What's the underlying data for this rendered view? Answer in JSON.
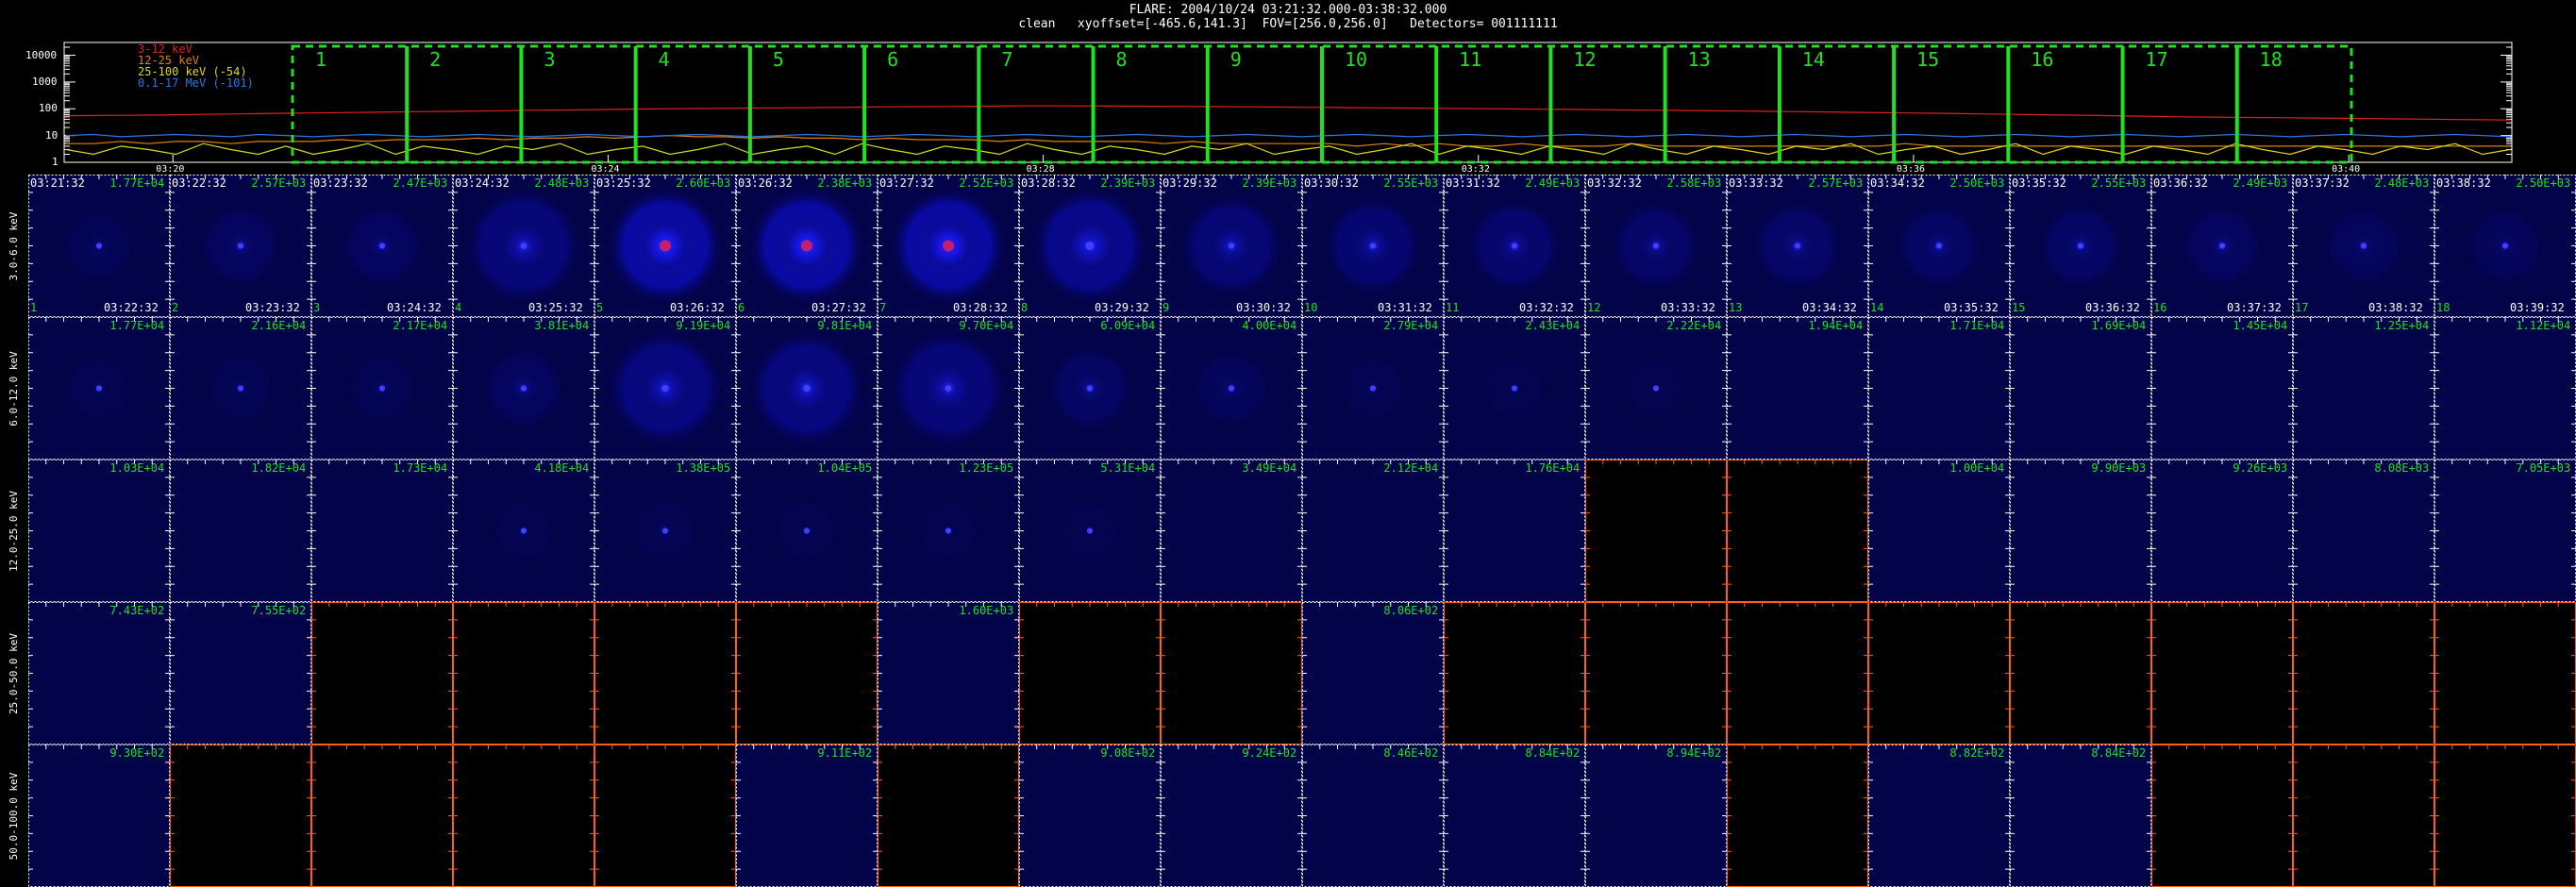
{
  "header": {
    "line1": "FLARE: 2004/10/24 03:21:32.000-03:38:32.000",
    "line2": "clean   xyoffset=[-465.6,141.3]  FOV=[256.0,256.0]   Detectors= 001111111"
  },
  "colors": {
    "red": "#e02020",
    "orange": "#e08010",
    "yellow": "#d8d820",
    "blue": "#2a78e8",
    "green": "#20e020",
    "frame": "#ff6010"
  },
  "chart_data": [
    {
      "type": "line",
      "title": "",
      "y_scale": "log",
      "ylim": [
        1,
        30000
      ],
      "y_ticks": [
        "10000",
        "1000",
        "100",
        "10",
        "1"
      ],
      "x_ticks": [
        "03:20",
        "03:24",
        "03:28",
        "03:32",
        "03:36",
        "03:40"
      ],
      "x_range": [
        "03:19:00",
        "03:41:30"
      ],
      "series": [
        {
          "name": "3-12 keV",
          "color_key": "red",
          "values": [
            55,
            56,
            57,
            58,
            60,
            62,
            64,
            66,
            68,
            70,
            72,
            74,
            76,
            78,
            80,
            82,
            85,
            88,
            90,
            92,
            95,
            98,
            100,
            102,
            104,
            106,
            108,
            110,
            112,
            115,
            118,
            120,
            122,
            124,
            126,
            128,
            128,
            127,
            126,
            125,
            124,
            122,
            120,
            118,
            116,
            114,
            112,
            110,
            108,
            106,
            104,
            102,
            100,
            98,
            96,
            94,
            92,
            90,
            88,
            86,
            84,
            82,
            80,
            78,
            76,
            74,
            72,
            70,
            68,
            66,
            64,
            62,
            60,
            58,
            56,
            54,
            52,
            50,
            49,
            48,
            47,
            46,
            45,
            44,
            43,
            42,
            41,
            40,
            39,
            38
          ]
        },
        {
          "name": "12-25 keV",
          "color_key": "orange",
          "values": [
            5,
            5,
            6,
            5,
            6,
            6,
            5,
            6,
            6,
            6,
            7,
            6,
            7,
            7,
            7,
            8,
            7,
            8,
            8,
            9,
            8,
            9,
            10,
            9,
            9,
            8,
            9,
            8,
            8,
            7,
            8,
            7,
            7,
            7,
            6,
            7,
            6,
            6,
            6,
            6,
            5,
            6,
            5,
            5,
            5,
            5,
            5,
            4,
            5,
            4,
            5,
            4,
            4,
            5,
            4,
            4,
            4,
            5,
            4,
            4,
            4,
            4,
            4,
            4,
            4,
            4,
            4,
            5,
            4,
            4,
            4,
            4,
            4,
            4,
            4,
            4,
            4,
            4,
            4,
            4,
            4,
            4,
            4,
            4,
            4,
            4,
            4,
            4,
            4,
            4
          ]
        },
        {
          "name": "25-100 keV (-54)",
          "color_key": "yellow",
          "values": [
            3,
            2,
            4,
            3,
            2,
            5,
            3,
            2,
            4,
            2,
            3,
            5,
            2,
            4,
            3,
            2,
            4,
            3,
            5,
            2,
            3,
            4,
            2,
            3,
            5,
            2,
            3,
            4,
            2,
            5,
            3,
            2,
            4,
            3,
            2,
            5,
            3,
            2,
            4,
            3,
            2,
            4,
            3,
            5,
            2,
            3,
            4,
            2,
            3,
            5,
            2,
            4,
            3,
            2,
            4,
            3,
            2,
            5,
            3,
            2,
            4,
            3,
            2,
            4,
            3,
            5,
            2,
            3,
            4,
            2,
            3,
            5,
            2,
            4,
            3,
            2,
            4,
            3,
            2,
            5,
            3,
            2,
            4,
            3,
            2,
            4,
            3,
            5,
            2,
            3
          ]
        },
        {
          "name": "0.1-17 MeV (-101)",
          "color_key": "blue",
          "values": [
            10,
            11,
            9,
            10,
            11,
            10,
            9,
            11,
            10,
            9,
            10,
            11,
            10,
            9,
            10,
            11,
            10,
            9,
            10,
            11,
            10,
            9,
            10,
            11,
            10,
            9,
            10,
            11,
            10,
            9,
            10,
            11,
            10,
            9,
            10,
            11,
            10,
            9,
            10,
            11,
            10,
            9,
            10,
            11,
            10,
            9,
            10,
            11,
            10,
            9,
            10,
            11,
            10,
            9,
            10,
            11,
            10,
            9,
            10,
            11,
            10,
            9,
            10,
            11,
            10,
            9,
            10,
            11,
            10,
            9,
            10,
            11,
            10,
            9,
            10,
            11,
            10,
            9,
            10,
            11,
            10,
            9,
            10,
            11,
            10,
            9,
            10,
            11,
            10,
            9
          ]
        }
      ],
      "intervals": [
        "1",
        "2",
        "3",
        "4",
        "5",
        "6",
        "7",
        "8",
        "9",
        "10",
        "11",
        "12",
        "13",
        "14",
        "15",
        "16",
        "17",
        "18"
      ]
    },
    {
      "type": "heatmap",
      "title": "",
      "energy_bands": [
        "3.0-6.0 keV",
        "6.0-12.0 keV",
        "12.0-25.0 keV",
        "25.0-50.0 keV",
        "50.0-100.0 keV"
      ],
      "start_times": [
        "03:21:32",
        "03:22:32",
        "03:23:32",
        "03:24:32",
        "03:25:32",
        "03:26:32",
        "03:27:32",
        "03:28:32",
        "03:29:32",
        "03:30:32",
        "03:31:32",
        "03:32:32",
        "03:33:32",
        "03:34:32",
        "03:35:32",
        "03:36:32",
        "03:37:32",
        "03:38:32"
      ],
      "end_times": [
        "03:22:32",
        "03:23:32",
        "03:24:32",
        "03:25:32",
        "03:26:32",
        "03:27:32",
        "03:28:32",
        "03:29:32",
        "03:30:32",
        "03:31:32",
        "03:32:32",
        "03:33:32",
        "03:34:32",
        "03:35:32",
        "03:36:32",
        "03:37:32",
        "03:38:32",
        "03:39:32"
      ],
      "interval_numbers": [
        "1",
        "2",
        "3",
        "4",
        "5",
        "6",
        "7",
        "8",
        "9",
        "10",
        "11",
        "12",
        "13",
        "14",
        "15",
        "16",
        "17",
        "18"
      ],
      "max_values": [
        [
          "1.77E+04",
          "2.57E+03",
          "2.47E+03",
          "2.48E+03",
          "2.60E+03",
          "2.38E+03",
          "2.52E+03",
          "2.39E+03",
          "2.39E+03",
          "2.55E+03",
          "2.49E+03",
          "2.58E+03",
          "2.57E+03",
          "2.50E+03",
          "2.55E+03",
          "2.49E+03",
          "2.48E+03",
          "2.50E+03"
        ],
        [
          "1.77E+04",
          "2.16E+04",
          "2.17E+04",
          "3.81E+04",
          "9.19E+04",
          "9.81E+04",
          "9.70E+04",
          "6.09E+04",
          "4.00E+04",
          "2.79E+04",
          "2.43E+04",
          "2.22E+04",
          "1.94E+04",
          "1.71E+04",
          "1.69E+04",
          "1.45E+04",
          "1.25E+04",
          "1.12E+04"
        ],
        [
          "1.03E+04",
          "1.82E+04",
          "1.73E+04",
          "4.18E+04",
          "1.38E+05",
          "1.04E+05",
          "1.23E+05",
          "5.31E+04",
          "3.49E+04",
          "2.12E+04",
          "1.76E+04",
          "",
          "",
          "1.00E+04",
          "9.90E+03",
          "9.26E+03",
          "8.08E+03",
          "7.05E+03"
        ],
        [
          "7.43E+02",
          "7.55E+02",
          "",
          "",
          "",
          "",
          "1.60E+03",
          "",
          "",
          "8.06E+02",
          "",
          "",
          "",
          "",
          "",
          "",
          "",
          ""
        ],
        [
          "9.30E+02",
          "",
          "",
          "",
          "",
          "9.11E+02",
          "",
          "9.08E+02",
          "9.24E+02",
          "8.46E+02",
          "8.84E+02",
          "8.94E+02",
          "",
          "8.82E+02",
          "8.84E+02",
          "",
          "",
          ""
        ]
      ],
      "empty_cells": [
        [],
        [],
        [
          11,
          12
        ],
        [
          2,
          3,
          4,
          5,
          7,
          8,
          10,
          11,
          12,
          13,
          14,
          15,
          16,
          17
        ],
        [
          1,
          2,
          3,
          4,
          6,
          12,
          15,
          16,
          17
        ]
      ],
      "intensity": [
        [
          0.15,
          0.25,
          0.25,
          0.55,
          1.0,
          1.0,
          1.0,
          0.75,
          0.5,
          0.45,
          0.4,
          0.35,
          0.35,
          0.3,
          0.3,
          0.25,
          0.22,
          0.2
        ],
        [
          0.1,
          0.12,
          0.12,
          0.25,
          0.6,
          0.6,
          0.55,
          0.3,
          0.2,
          0.1,
          0.08,
          0.06,
          0.05,
          0.04,
          0.04,
          0.03,
          0.03,
          0.03
        ],
        [
          0.05,
          0.05,
          0.05,
          0.08,
          0.1,
          0.08,
          0.08,
          0.06,
          0.05,
          0.05,
          0.05,
          0,
          0,
          0.05,
          0.05,
          0.05,
          0.05,
          0.05
        ],
        [
          0.05,
          0.05,
          0,
          0,
          0,
          0,
          0.05,
          0,
          0,
          0.05,
          0,
          0,
          0,
          0,
          0,
          0,
          0,
          0
        ],
        [
          0.05,
          0,
          0,
          0,
          0,
          0.05,
          0,
          0.05,
          0.05,
          0.05,
          0.05,
          0.05,
          0,
          0.05,
          0.05,
          0,
          0,
          0
        ]
      ]
    }
  ]
}
